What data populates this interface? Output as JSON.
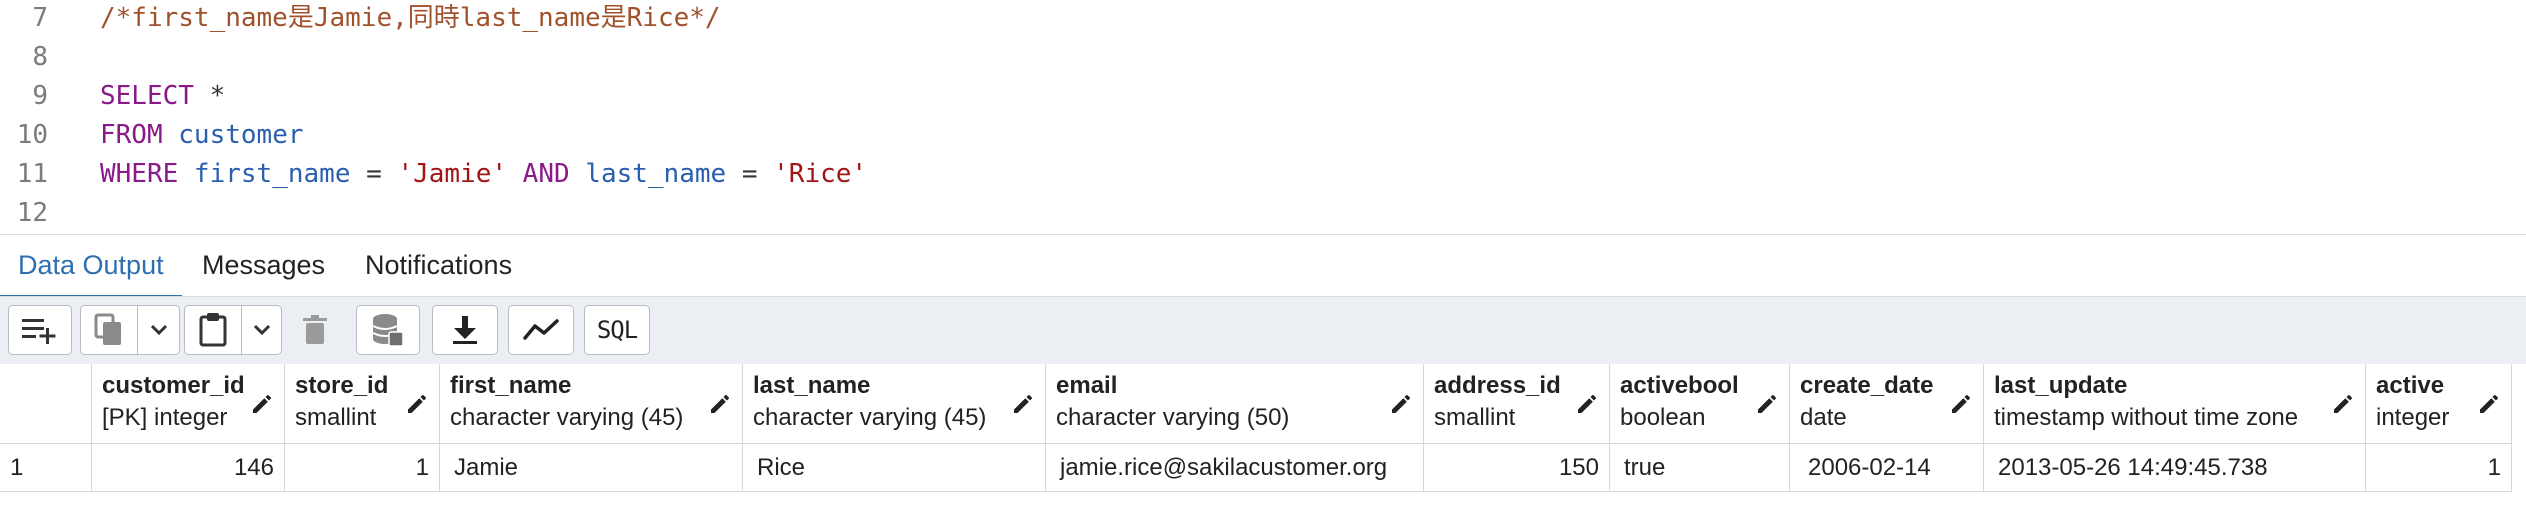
{
  "editor": {
    "lines": [
      {
        "n": "7",
        "tokens": [
          {
            "t": "/*first_name是Jamie,同時last_name是Rice*/",
            "c": "t-comment"
          }
        ]
      },
      {
        "n": "8",
        "tokens": []
      },
      {
        "n": "9",
        "tokens": [
          {
            "t": "SELECT",
            "c": "t-kw"
          },
          {
            "t": " *",
            "c": "t-op"
          }
        ]
      },
      {
        "n": "10",
        "tokens": [
          {
            "t": "FROM",
            "c": "t-kw"
          },
          {
            "t": " customer",
            "c": "t-ident"
          }
        ]
      },
      {
        "n": "11",
        "tokens": [
          {
            "t": "WHERE",
            "c": "t-kw"
          },
          {
            "t": " first_name",
            "c": "t-ident"
          },
          {
            "t": " = ",
            "c": "t-op"
          },
          {
            "t": "'Jamie'",
            "c": "t-str"
          },
          {
            "t": " AND",
            "c": "t-kw"
          },
          {
            "t": " last_name",
            "c": "t-ident"
          },
          {
            "t": " = ",
            "c": "t-op"
          },
          {
            "t": "'Rice'",
            "c": "t-str"
          }
        ]
      },
      {
        "n": "12",
        "tokens": []
      }
    ]
  },
  "tabs": {
    "data_output": "Data Output",
    "messages": "Messages",
    "notifications": "Notifications"
  },
  "toolbar": {
    "sql_label": "SQL"
  },
  "grid": {
    "columns": [
      {
        "name": "customer_id",
        "type": "[PK] integer"
      },
      {
        "name": "store_id",
        "type": "smallint"
      },
      {
        "name": "first_name",
        "type": "character varying (45)"
      },
      {
        "name": "last_name",
        "type": "character varying (45)"
      },
      {
        "name": "email",
        "type": "character varying (50)"
      },
      {
        "name": "address_id",
        "type": "smallint"
      },
      {
        "name": "activebool",
        "type": "boolean"
      },
      {
        "name": "create_date",
        "type": "date"
      },
      {
        "name": "last_update",
        "type": "timestamp without time zone"
      },
      {
        "name": "active",
        "type": "integer"
      }
    ],
    "rows": [
      {
        "rownum": "1",
        "cells": [
          "146",
          "1",
          "Jamie",
          "Rice",
          "jamie.rice@sakilacustomer.org",
          "150",
          "true",
          "2006-02-14",
          "2013-05-26 14:49:45.738",
          "1"
        ]
      }
    ]
  },
  "colors": {
    "accent": "#2f6fb0",
    "keyword": "#8a1a8a",
    "identifier": "#2a5fb0",
    "string": "#a31515",
    "comment": "#a0522d"
  }
}
